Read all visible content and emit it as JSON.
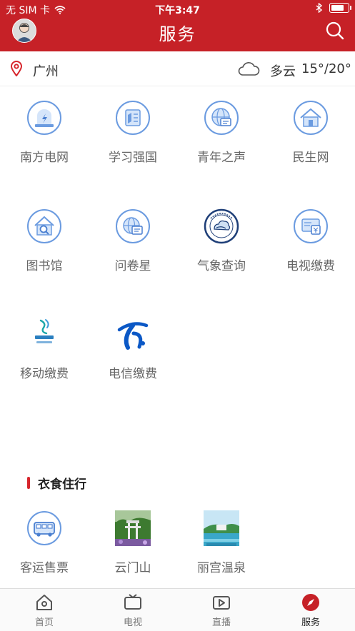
{
  "status_bar": {
    "carrier": "无 SIM 卡",
    "time": "下午3:47",
    "battery_level": 0.85
  },
  "header": {
    "title": "服务"
  },
  "location": {
    "city": "广州",
    "weather": "多云",
    "temperature": "15°/20°"
  },
  "services": [
    {
      "label": "南方电网",
      "icon": "power-grid-icon"
    },
    {
      "label": "学习强国",
      "icon": "study-book-icon"
    },
    {
      "label": "青年之声",
      "icon": "youth-voice-globe-icon"
    },
    {
      "label": "民生网",
      "icon": "home-icon"
    },
    {
      "label": "图书馆",
      "icon": "library-search-icon"
    },
    {
      "label": "问卷星",
      "icon": "survey-globe-icon"
    },
    {
      "label": "气象查询",
      "icon": "meteorology-seal-icon"
    },
    {
      "label": "电视缴费",
      "icon": "tv-payment-icon"
    },
    {
      "label": "移动缴费",
      "icon": "china-mobile-logo"
    },
    {
      "label": "电信缴费",
      "icon": "china-telecom-logo"
    }
  ],
  "section": {
    "title": "衣食住行"
  },
  "travel": [
    {
      "label": "客运售票",
      "icon": "bus-icon"
    },
    {
      "label": "云门山",
      "icon": "yunmen-mountain-thumb"
    },
    {
      "label": "丽宫温泉",
      "icon": "ligong-hotspring-thumb"
    }
  ],
  "tabs": [
    {
      "label": "首页",
      "icon": "home-tab-icon"
    },
    {
      "label": "电视",
      "icon": "tv-tab-icon"
    },
    {
      "label": "直播",
      "icon": "live-tab-icon"
    },
    {
      "label": "服务",
      "icon": "compass-tab-icon",
      "active": true
    }
  ],
  "colors": {
    "primary": "#c62127",
    "icon_blue": "#5b8fd9",
    "icon_fill": "#eef4fc"
  }
}
